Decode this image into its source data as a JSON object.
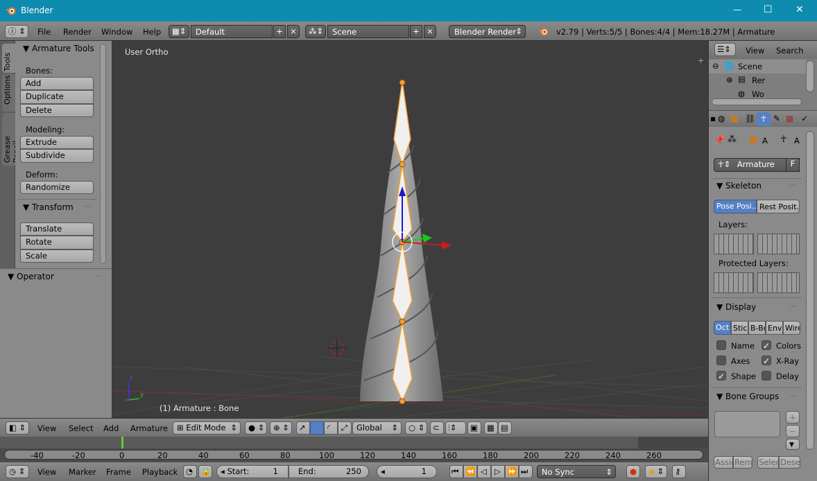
{
  "window": {
    "title": "Blender",
    "minimize": "—",
    "maximize": "☐",
    "close": "✕"
  },
  "menubar": {
    "file": "File",
    "render": "Render",
    "window": "Window",
    "help": "Help",
    "layout": "Default",
    "scene": "Scene",
    "engine": "Blender Render",
    "stats": "v2.79 | Verts:5/5 | Bones:4/4 | Mem:18.27M | Armature"
  },
  "toolshelf": {
    "tabs": [
      "Tools",
      "Options",
      "Grease Pencil"
    ],
    "panel_title": "Armature Tools",
    "bones_label": "Bones:",
    "add": "Add",
    "duplicate": "Duplicate",
    "delete": "Delete",
    "modeling_label": "Modeling:",
    "extrude": "Extrude",
    "subdivide": "Subdivide",
    "deform_label": "Deform:",
    "randomize": "Randomize",
    "transform_title": "Transform",
    "translate": "Translate",
    "rotate": "Rotate",
    "scale": "Scale",
    "operator_title": "Operator"
  },
  "viewport": {
    "view_name": "User Ortho",
    "object_info": "(1) Armature : Bone",
    "axis_z": "z",
    "axis_y": "y"
  },
  "view3d_header": {
    "view": "View",
    "select": "Select",
    "add": "Add",
    "armature": "Armature",
    "mode": "Edit Mode",
    "orientation": "Global"
  },
  "timeline": {
    "ticks": [
      "-40",
      "-20",
      "0",
      "20",
      "40",
      "60",
      "80",
      "100",
      "120",
      "140",
      "160",
      "180",
      "200",
      "220",
      "240",
      "260"
    ],
    "view": "View",
    "marker": "Marker",
    "frame": "Frame",
    "playback": "Playback",
    "start_label": "Start:",
    "start_value": "1",
    "end_label": "End:",
    "end_value": "250",
    "current_frame": "1",
    "sync": "No Sync"
  },
  "outliner": {
    "view": "View",
    "search": "Search",
    "items": [
      "Scene",
      "Rer",
      "Wo"
    ]
  },
  "properties": {
    "object_name": "Armature",
    "f_label": "F",
    "crumb_a1": "A",
    "crumb_a2": "A",
    "skeleton_title": "Skeleton",
    "pose_position": "Pose Posi...",
    "rest_position": "Rest Posit...",
    "layers_label": "Layers:",
    "protected_label": "Protected Layers:",
    "display_title": "Display",
    "display_types": [
      "Oct",
      "Stic",
      "B-Bo",
      "Enve",
      "Wire"
    ],
    "name": "Name",
    "colors": "Colors",
    "axes": "Axes",
    "xray": "X-Ray",
    "shape": "Shape",
    "delay": "Delay",
    "bone_groups_title": "Bone Groups",
    "assign": "Assig",
    "remove": "Rem",
    "select": "Selec",
    "deselect": "Desel"
  },
  "colors": {
    "titlebar": "#0f8bb0",
    "accent": "#5680c2",
    "bone_outline": "#f0a030"
  }
}
